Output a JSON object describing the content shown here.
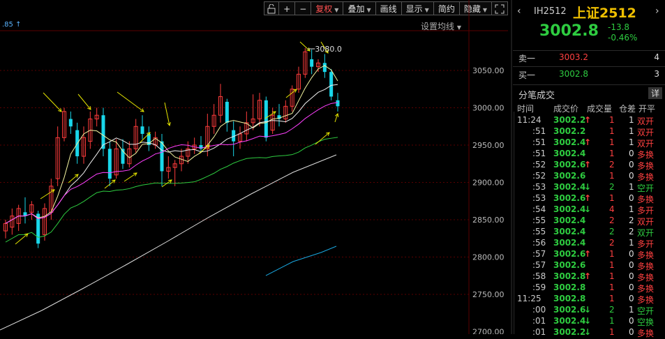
{
  "toolbar": {
    "lock_icon": "lock-icon",
    "zoom_in": "+",
    "zoom_out": "−",
    "adjust": "复权",
    "overlay": "叠加",
    "draw": "画线",
    "display": "显示",
    "simple": "简约",
    "hide": "隐藏",
    "expand_icon": "expand-icon"
  },
  "chart": {
    "ma_label": ".85 ↑",
    "settings": "设置均线",
    "max_label": "3080.0",
    "y_ticks": [
      "3050.00",
      "3000.00",
      "2950.00",
      "2900.00",
      "2850.00",
      "2800.00",
      "2750.00",
      "2700.00"
    ]
  },
  "chart_data": {
    "type": "candlestick",
    "ylim": [
      2700,
      3100
    ],
    "y_ticks": [
      2750,
      2800,
      2850,
      2900,
      2950,
      3000,
      3050
    ],
    "max_annotation": 3080.0,
    "candles": [
      {
        "o": 2835,
        "c": 2845,
        "h": 2850,
        "l": 2825
      },
      {
        "o": 2840,
        "c": 2855,
        "h": 2865,
        "l": 2830
      },
      {
        "o": 2845,
        "c": 2865,
        "h": 2870,
        "l": 2835
      },
      {
        "o": 2860,
        "c": 2855,
        "h": 2880,
        "l": 2845
      },
      {
        "o": 2860,
        "c": 2870,
        "h": 2875,
        "l": 2850
      },
      {
        "o": 2858,
        "c": 2818,
        "h": 2862,
        "l": 2812
      },
      {
        "o": 2830,
        "c": 2865,
        "h": 2872,
        "l": 2822
      },
      {
        "o": 2860,
        "c": 2895,
        "h": 2905,
        "l": 2850
      },
      {
        "o": 2905,
        "c": 2960,
        "h": 2975,
        "l": 2895
      },
      {
        "o": 2960,
        "c": 2995,
        "h": 3000,
        "l": 2955
      },
      {
        "o": 2985,
        "c": 2975,
        "h": 2995,
        "l": 2965
      },
      {
        "o": 2970,
        "c": 2935,
        "h": 2980,
        "l": 2925
      },
      {
        "o": 2935,
        "c": 2960,
        "h": 2975,
        "l": 2925
      },
      {
        "o": 2955,
        "c": 2985,
        "h": 2995,
        "l": 2945
      },
      {
        "o": 2985,
        "c": 2990,
        "h": 3000,
        "l": 2975
      },
      {
        "o": 2990,
        "c": 2945,
        "h": 3000,
        "l": 2935
      },
      {
        "o": 2945,
        "c": 2905,
        "h": 2955,
        "l": 2895
      },
      {
        "o": 2910,
        "c": 2945,
        "h": 2958,
        "l": 2905
      },
      {
        "o": 2945,
        "c": 2925,
        "h": 2958,
        "l": 2918
      },
      {
        "o": 2925,
        "c": 2945,
        "h": 2955,
        "l": 2920
      },
      {
        "o": 2945,
        "c": 2975,
        "h": 2985,
        "l": 2940
      },
      {
        "o": 2975,
        "c": 2965,
        "h": 2990,
        "l": 2958
      },
      {
        "o": 2965,
        "c": 2950,
        "h": 2975,
        "l": 2942
      },
      {
        "o": 2950,
        "c": 2960,
        "h": 2968,
        "l": 2945
      },
      {
        "o": 2955,
        "c": 2915,
        "h": 2965,
        "l": 2895
      },
      {
        "o": 2915,
        "c": 2920,
        "h": 2935,
        "l": 2905
      },
      {
        "o": 2920,
        "c": 2925,
        "h": 2930,
        "l": 2895
      },
      {
        "o": 2925,
        "c": 2935,
        "h": 2945,
        "l": 2915
      },
      {
        "o": 2935,
        "c": 2945,
        "h": 2955,
        "l": 2925
      },
      {
        "o": 2945,
        "c": 2950,
        "h": 2960,
        "l": 2938
      },
      {
        "o": 2950,
        "c": 2945,
        "h": 2962,
        "l": 2940
      },
      {
        "o": 2945,
        "c": 2975,
        "h": 2992,
        "l": 2935
      },
      {
        "o": 2975,
        "c": 2990,
        "h": 3005,
        "l": 2965
      },
      {
        "o": 2990,
        "c": 3015,
        "h": 3032,
        "l": 2980
      },
      {
        "o": 3008,
        "c": 2980,
        "h": 3012,
        "l": 2968
      },
      {
        "o": 2970,
        "c": 2955,
        "h": 2982,
        "l": 2935
      },
      {
        "o": 2955,
        "c": 2965,
        "h": 2975,
        "l": 2945
      },
      {
        "o": 2965,
        "c": 2980,
        "h": 2995,
        "l": 2955
      },
      {
        "o": 2980,
        "c": 2985,
        "h": 3018,
        "l": 2970
      },
      {
        "o": 2985,
        "c": 3010,
        "h": 3020,
        "l": 2975
      },
      {
        "o": 3010,
        "c": 2960,
        "h": 3015,
        "l": 2955
      },
      {
        "o": 2970,
        "c": 2990,
        "h": 3000,
        "l": 2965
      },
      {
        "o": 2990,
        "c": 2985,
        "h": 3005,
        "l": 2975
      },
      {
        "o": 2985,
        "c": 3002,
        "h": 3010,
        "l": 2980
      },
      {
        "o": 3002,
        "c": 3025,
        "h": 3030,
        "l": 2995
      },
      {
        "o": 3025,
        "c": 3045,
        "h": 3055,
        "l": 3020
      },
      {
        "o": 3045,
        "c": 3075,
        "h": 3080,
        "l": 3040
      },
      {
        "o": 3065,
        "c": 3055,
        "h": 3078,
        "l": 3045
      },
      {
        "o": 3055,
        "c": 3060,
        "h": 3065,
        "l": 3048
      },
      {
        "o": 3060,
        "c": 3048,
        "h": 3072,
        "l": 3040
      },
      {
        "o": 3048,
        "c": 3015,
        "h": 3052,
        "l": 3010
      },
      {
        "o": 3010,
        "c": 3002,
        "h": 3020,
        "l": 2995
      }
    ]
  },
  "quote": {
    "code": "IH2512",
    "name": "上证2512",
    "price": "3002.8",
    "change": "-13.8",
    "change_pct": "-0.46%",
    "sell_label": "卖一",
    "sell_price": "3003.2",
    "sell_vol": "4",
    "buy_label": "买一",
    "buy_price": "3002.8",
    "buy_vol": "3",
    "tick_title": "分笔成交",
    "detail_btn": "详",
    "col_time": "时间",
    "col_price": "成交价",
    "col_vol": "成交量",
    "col_oi": "仓差",
    "col_type": "开平"
  },
  "ticks": [
    {
      "t": "11:24",
      "p": "3002.2",
      "a": "up",
      "v": "1",
      "oi": "1",
      "k": "双开",
      "kc": "up"
    },
    {
      "t": ":51",
      "p": "3002.2",
      "a": "",
      "v": "1",
      "oi": "1",
      "k": "双开",
      "kc": "up"
    },
    {
      "t": ":51",
      "p": "3002.4",
      "a": "up",
      "v": "1",
      "oi": "1",
      "k": "双开",
      "kc": "up"
    },
    {
      "t": ":51",
      "p": "3002.4",
      "a": "",
      "v": "1",
      "oi": "0",
      "k": "多换",
      "kc": "up"
    },
    {
      "t": ":52",
      "p": "3002.6",
      "a": "up",
      "v": "2",
      "oi": "0",
      "k": "多换",
      "kc": "up"
    },
    {
      "t": ":52",
      "p": "3002.6",
      "a": "",
      "v": "1",
      "oi": "0",
      "k": "多换",
      "kc": "up"
    },
    {
      "t": ":53",
      "p": "3002.4",
      "a": "dn",
      "v": "2",
      "oi": "1",
      "k": "空开",
      "kc": "dn"
    },
    {
      "t": ":53",
      "p": "3002.6",
      "a": "up",
      "v": "1",
      "oi": "0",
      "k": "多换",
      "kc": "up"
    },
    {
      "t": ":54",
      "p": "3002.4",
      "a": "dn",
      "v": "4",
      "oi": "1",
      "k": "多开",
      "kc": "up"
    },
    {
      "t": ":55",
      "p": "3002.4",
      "a": "",
      "v": "2",
      "oi": "2",
      "k": "双开",
      "kc": "up"
    },
    {
      "t": ":55",
      "p": "3002.4",
      "a": "",
      "v": "2",
      "oi": "2",
      "k": "双开",
      "kc": "dn"
    },
    {
      "t": ":56",
      "p": "3002.4",
      "a": "",
      "v": "2",
      "oi": "1",
      "k": "多开",
      "kc": "up"
    },
    {
      "t": ":57",
      "p": "3002.6",
      "a": "up",
      "v": "1",
      "oi": "0",
      "k": "多换",
      "kc": "up"
    },
    {
      "t": ":57",
      "p": "3002.6",
      "a": "",
      "v": "1",
      "oi": "0",
      "k": "多换",
      "kc": "up"
    },
    {
      "t": ":58",
      "p": "3002.8",
      "a": "up",
      "v": "1",
      "oi": "0",
      "k": "多换",
      "kc": "up"
    },
    {
      "t": ":59",
      "p": "3002.8",
      "a": "",
      "v": "1",
      "oi": "0",
      "k": "多换",
      "kc": "up"
    },
    {
      "t": "11:25",
      "p": "3002.8",
      "a": "",
      "v": "1",
      "oi": "0",
      "k": "多换",
      "kc": "up"
    },
    {
      "t": ":00",
      "p": "3002.6",
      "a": "dn",
      "v": "2",
      "oi": "1",
      "k": "空开",
      "kc": "dn"
    },
    {
      "t": ":01",
      "p": "3002.4",
      "a": "dn",
      "v": "1",
      "oi": "0",
      "k": "空换",
      "kc": "dn"
    },
    {
      "t": ":01",
      "p": "3002.2",
      "a": "dn",
      "v": "1",
      "oi": "0",
      "k": "多换",
      "kc": "up"
    }
  ]
}
